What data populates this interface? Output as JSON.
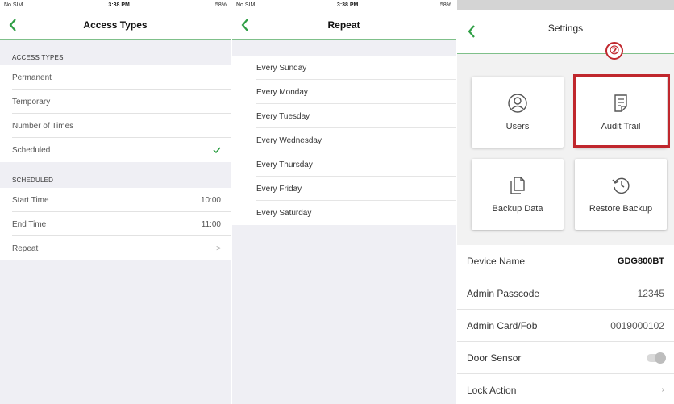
{
  "screen1": {
    "status": {
      "carrier": "No SIM",
      "time": "3:38 PM",
      "battery": "58%"
    },
    "title": "Access Types",
    "section1_header": "ACCESS TYPES",
    "access_types": [
      {
        "label": "Permanent"
      },
      {
        "label": "Temporary"
      },
      {
        "label": "Number of Times"
      },
      {
        "label": "Scheduled",
        "checked": true
      }
    ],
    "section2_header": "SCHEDULED",
    "scheduled": [
      {
        "label": "Start Time",
        "value": "10:00"
      },
      {
        "label": "End Time",
        "value": "11:00"
      },
      {
        "label": "Repeat",
        "value": ">"
      }
    ]
  },
  "screen2": {
    "status": {
      "carrier": "No SIM",
      "time": "3:38 PM",
      "battery": "58%"
    },
    "title": "Repeat",
    "days": [
      "Every Sunday",
      "Every Monday",
      "Every Tuesday",
      "Every Wednesday",
      "Every Thursday",
      "Every Friday",
      "Every Saturday"
    ]
  },
  "screen3": {
    "title": "Settings",
    "annotation": "②",
    "tiles": [
      {
        "label": "Users",
        "icon": "user-icon"
      },
      {
        "label": "Audit Trail",
        "icon": "audit-icon"
      },
      {
        "label": "Backup Data",
        "icon": "backup-icon"
      },
      {
        "label": "Restore Backup",
        "icon": "restore-icon"
      }
    ],
    "rows": [
      {
        "label": "Device Name",
        "value": "GDG800BT"
      },
      {
        "label": "Admin Passcode",
        "value": "12345"
      },
      {
        "label": "Admin Card/Fob",
        "value": "0019000102"
      },
      {
        "label": "Door Sensor"
      },
      {
        "label": "Lock Action"
      }
    ]
  },
  "colors": {
    "accent": "#2e9e44",
    "highlight": "#c0272d"
  }
}
